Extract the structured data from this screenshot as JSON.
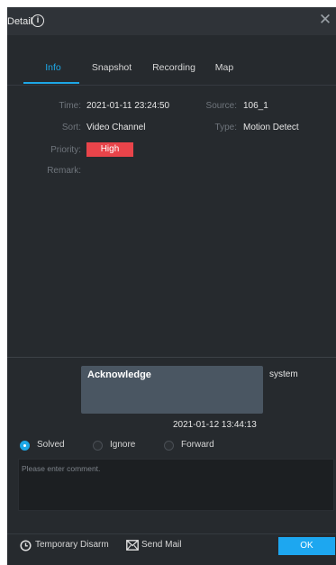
{
  "header": {
    "title": "Detail",
    "info_icon": "info-circle-icon",
    "close_icon": "close-icon"
  },
  "tabs": [
    {
      "label": "Info",
      "active": true
    },
    {
      "label": "Snapshot",
      "active": false
    },
    {
      "label": "Recording",
      "active": false
    },
    {
      "label": "Map",
      "active": false
    }
  ],
  "info": {
    "time_label": "Time:",
    "time_value": "2021-01-11 23:24:50",
    "source_label": "Source:",
    "source_value": "106_1",
    "sort_label": "Sort:",
    "sort_value": "Video Channel",
    "type_label": "Type:",
    "type_value": "Motion Detect",
    "priority_label": "Priority:",
    "priority_value": "High",
    "remark_label": "Remark:"
  },
  "acknowledge": {
    "text": "Acknowledge",
    "user": "system",
    "time": "2021-01-12 13:44:13"
  },
  "actions": {
    "options": [
      {
        "label": "Solved",
        "selected": true
      },
      {
        "label": "Ignore",
        "selected": false
      },
      {
        "label": "Forward",
        "selected": false
      }
    ],
    "comment_placeholder": "Please enter comment."
  },
  "footer": {
    "temporary_disarm": "Temporary Disarm",
    "send_mail": "Send Mail",
    "ok": "OK"
  },
  "colors": {
    "accent": "#1da7e6",
    "priority_high": "#e8444a",
    "panel_bg": "#262a2e"
  }
}
